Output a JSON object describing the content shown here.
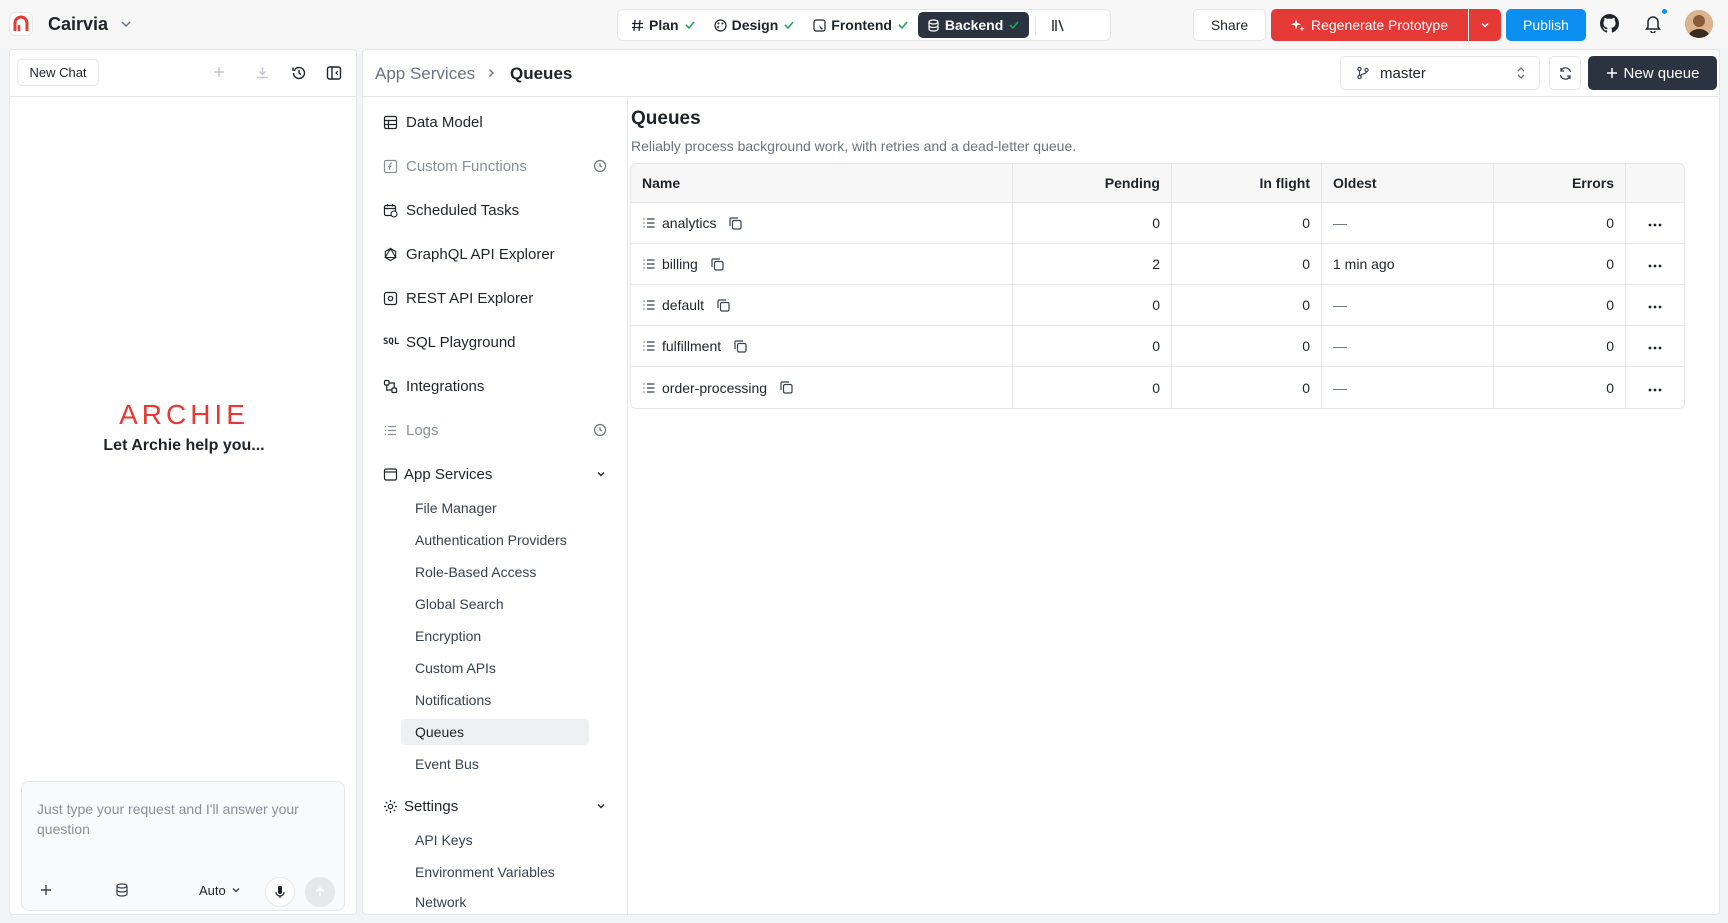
{
  "app": {
    "name": "Cairvia"
  },
  "phases": [
    {
      "label": "Plan",
      "icon": "hash-icon",
      "done": true
    },
    {
      "label": "Design",
      "icon": "palette-icon",
      "done": true
    },
    {
      "label": "Frontend",
      "icon": "frontend-icon",
      "done": true
    },
    {
      "label": "Backend",
      "icon": "database-icon",
      "done": true,
      "active": true
    }
  ],
  "topbar": {
    "share": "Share",
    "regenerate": "Regenerate Prototype",
    "publish": "Publish"
  },
  "chat": {
    "new_chat": "New Chat",
    "brand": "ARCHIE",
    "tagline": "Let Archie help you...",
    "placeholder": "Just type your request and I'll answer your question",
    "mode": "Auto"
  },
  "breadcrumb": {
    "parent": "App Services",
    "current": "Queues"
  },
  "branch": {
    "name": "master"
  },
  "actions": {
    "new_queue": "New queue"
  },
  "nav": {
    "items": [
      {
        "label": "Data Model",
        "icon": "table-icon"
      },
      {
        "label": "Custom Functions",
        "icon": "function-icon",
        "dim": true,
        "clock": true
      },
      {
        "label": "Scheduled Tasks",
        "icon": "calendar-clock-icon"
      },
      {
        "label": "GraphQL API Explorer",
        "icon": "graphql-icon"
      },
      {
        "label": "REST API Explorer",
        "icon": "rest-api-icon"
      },
      {
        "label": "SQL Playground",
        "icon": "sql-icon"
      },
      {
        "label": "Integrations",
        "icon": "integrations-icon"
      },
      {
        "label": "Logs",
        "icon": "logs-icon",
        "dim": true,
        "clock": true
      }
    ],
    "app_services": {
      "label": "App Services",
      "items": [
        "File Manager",
        "Authentication Providers",
        "Role-Based Access",
        "Global Search",
        "Encryption",
        "Custom APIs",
        "Notifications",
        "Queues",
        "Event Bus"
      ],
      "active": "Queues"
    },
    "settings": {
      "label": "Settings",
      "items": [
        "API Keys",
        "Environment Variables",
        "Network"
      ]
    }
  },
  "page": {
    "title": "Queues",
    "subtitle": "Reliably process background work, with retries and a dead-letter queue."
  },
  "table": {
    "columns": [
      "Name",
      "Pending",
      "In flight",
      "Oldest",
      "Errors"
    ],
    "rows": [
      {
        "name": "analytics",
        "pending": "0",
        "in_flight": "0",
        "oldest": "—",
        "errors": "0"
      },
      {
        "name": "billing",
        "pending": "2",
        "in_flight": "0",
        "oldest": "1 min ago",
        "errors": "0"
      },
      {
        "name": "default",
        "pending": "0",
        "in_flight": "0",
        "oldest": "—",
        "errors": "0"
      },
      {
        "name": "fulfillment",
        "pending": "0",
        "in_flight": "0",
        "oldest": "—",
        "errors": "0"
      },
      {
        "name": "order-processing",
        "pending": "0",
        "in_flight": "0",
        "oldest": "—",
        "errors": "0"
      }
    ]
  },
  "colors": {
    "accent": "#e53935",
    "primary": "#0a8ef0",
    "dark": "#2b3240",
    "success": "#22a55b"
  }
}
